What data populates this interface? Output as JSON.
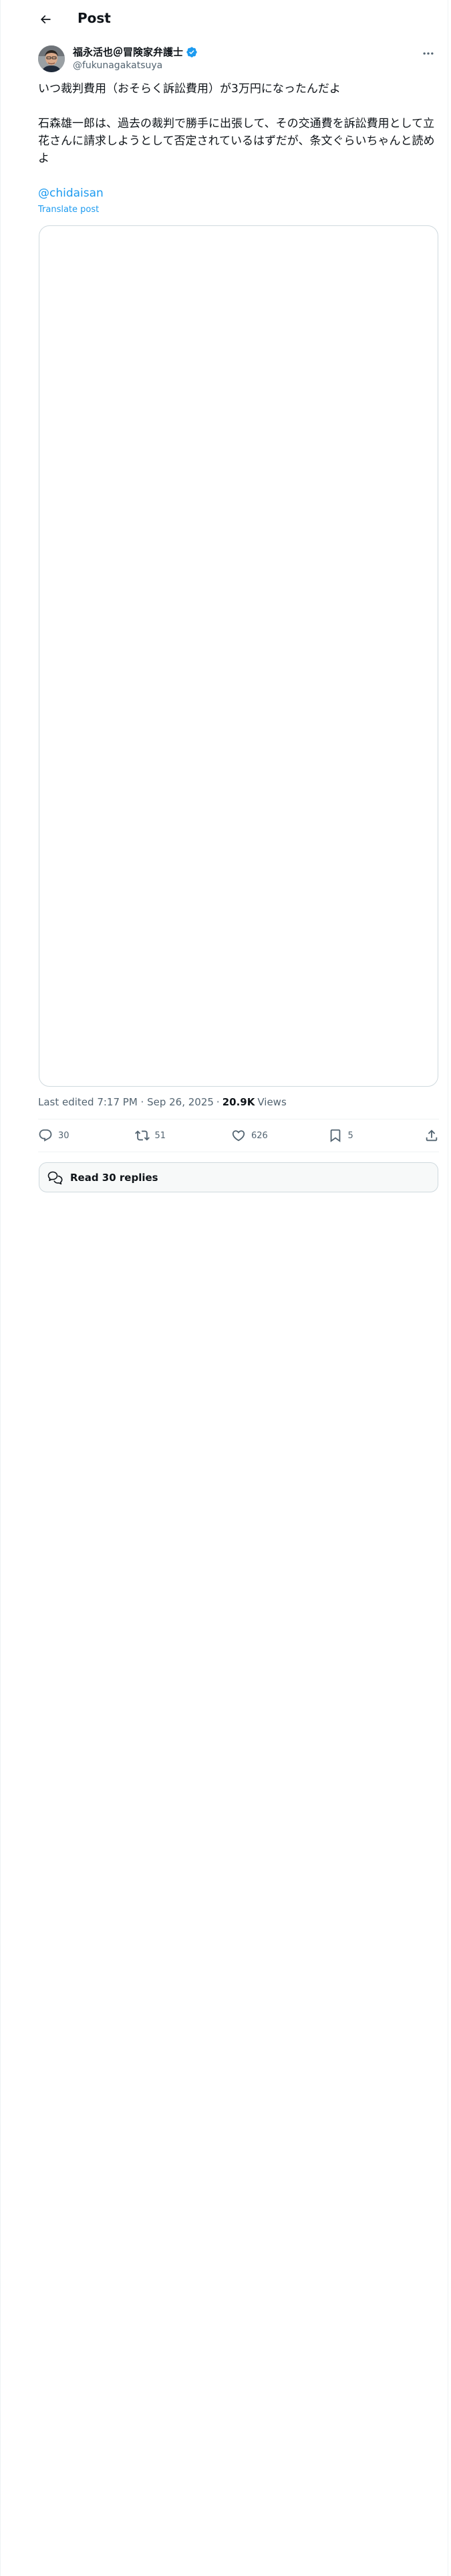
{
  "header": {
    "title": "Post"
  },
  "author": {
    "name": "福永活也＠冒険家弁護士",
    "handle": "@fukunagakatsuya",
    "verified": true
  },
  "tweet": {
    "paragraphs": [
      "いつ裁判費用（おそらく訴訟費用）が3万円になったんだよ",
      "石森雄一郎は、過去の裁判で勝手に出張して、その交通費を訴訟費用として立花さんに請求しようとして否定されているはずだが、条文ぐらいちゃんと読めよ"
    ],
    "mention": "@chidaisan",
    "translate_label": "Translate post"
  },
  "meta": {
    "edited": "Last edited 7:17 PM · Sep 26, 2025",
    "separator": "·",
    "views_count": "20.9K",
    "views_label": "Views"
  },
  "actions": {
    "replies": "30",
    "reposts": "51",
    "likes": "626",
    "bookmarks": "5"
  },
  "replies_button": {
    "label": "Read 30 replies"
  },
  "colors": {
    "accent": "#1d9bf0",
    "text": "#0f1419",
    "secondary": "#536471",
    "border": "#cfd9de"
  }
}
